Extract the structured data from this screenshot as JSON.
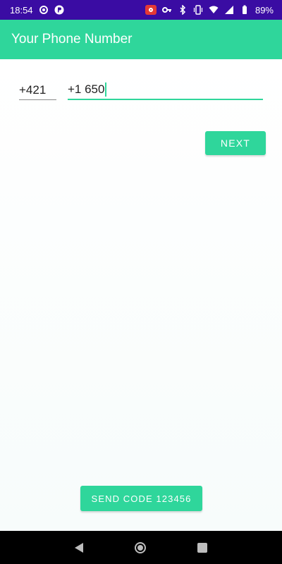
{
  "status_bar": {
    "time": "18:54",
    "battery": "89%",
    "icons": [
      "settings-icon",
      "p-icon",
      "screen-record-icon",
      "key-icon",
      "bluetooth-icon",
      "vibrate-icon",
      "wifi-icon",
      "signal-icon",
      "battery-icon"
    ]
  },
  "app_bar": {
    "title": "Your Phone Number"
  },
  "form": {
    "country_code": "+421",
    "phone_value": "+1 650",
    "next_label": "NEXT"
  },
  "footer": {
    "send_code_label": "SEND CODE 123456"
  },
  "colors": {
    "accent": "#2fd69b",
    "status_bar": "#3a0ca3"
  }
}
